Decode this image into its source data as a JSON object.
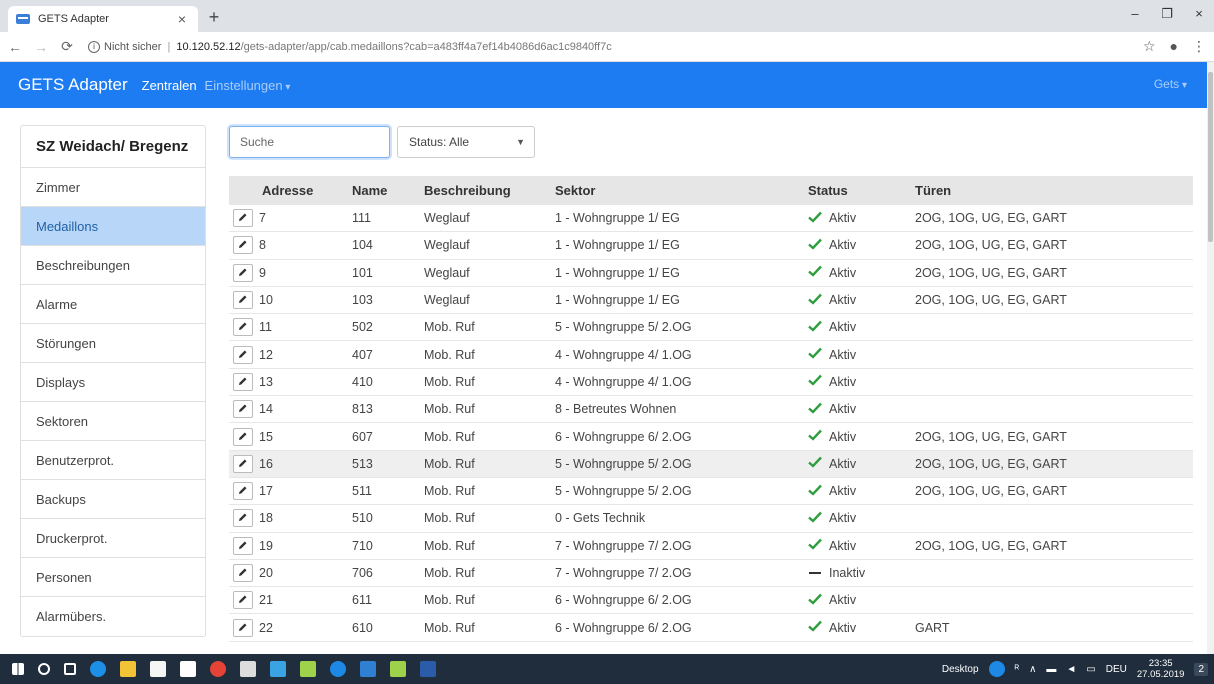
{
  "browser": {
    "tab_title": "GETS Adapter",
    "tab_close": "×",
    "new_tab": "+",
    "win_min": "–",
    "win_max": "❐",
    "win_close": "×",
    "url_security": "Nicht sicher",
    "url_host": "10.120.52.12",
    "url_path": "/gets-adapter/app/cab.medaillons?cab=a483ff4a7ef14b4086d6ac1c9840ff7c"
  },
  "navbar": {
    "brand": "GETS Adapter",
    "links": [
      "Zentralen",
      "Einstellungen"
    ],
    "user": "Gets"
  },
  "sidebar": {
    "title": "SZ Weidach/ Bregenz",
    "items": [
      "Zimmer",
      "Medaillons",
      "Beschreibungen",
      "Alarme",
      "Störungen",
      "Displays",
      "Sektoren",
      "Benutzerprot.",
      "Backups",
      "Druckerprot.",
      "Personen",
      "Alarmübers."
    ],
    "active_index": 1
  },
  "filters": {
    "search_placeholder": "Suche",
    "status_label": "Status: Alle"
  },
  "table": {
    "headers": [
      "Adresse",
      "Name",
      "Beschreibung",
      "Sektor",
      "Status",
      "Türen"
    ],
    "rows": [
      {
        "adresse": "7",
        "name": "111",
        "beschreibung": "Weglauf",
        "sektor": "1 - Wohngruppe 1/ EG",
        "status": "Aktiv",
        "tueren": "2OG, 1OG, UG, EG, GART"
      },
      {
        "adresse": "8",
        "name": "104",
        "beschreibung": "Weglauf",
        "sektor": "1 - Wohngruppe 1/ EG",
        "status": "Aktiv",
        "tueren": "2OG, 1OG, UG, EG, GART"
      },
      {
        "adresse": "9",
        "name": "101",
        "beschreibung": "Weglauf",
        "sektor": "1 - Wohngruppe 1/ EG",
        "status": "Aktiv",
        "tueren": "2OG, 1OG, UG, EG, GART"
      },
      {
        "adresse": "10",
        "name": "103",
        "beschreibung": "Weglauf",
        "sektor": "1 - Wohngruppe 1/ EG",
        "status": "Aktiv",
        "tueren": "2OG, 1OG, UG, EG, GART"
      },
      {
        "adresse": "11",
        "name": "502",
        "beschreibung": "Mob. Ruf",
        "sektor": "5 - Wohngruppe 5/ 2.OG",
        "status": "Aktiv",
        "tueren": ""
      },
      {
        "adresse": "12",
        "name": "407",
        "beschreibung": "Mob. Ruf",
        "sektor": "4 - Wohngruppe 4/ 1.OG",
        "status": "Aktiv",
        "tueren": ""
      },
      {
        "adresse": "13",
        "name": "410",
        "beschreibung": "Mob. Ruf",
        "sektor": "4 - Wohngruppe 4/ 1.OG",
        "status": "Aktiv",
        "tueren": ""
      },
      {
        "adresse": "14",
        "name": "813",
        "beschreibung": "Mob. Ruf",
        "sektor": "8 - Betreutes Wohnen",
        "status": "Aktiv",
        "tueren": ""
      },
      {
        "adresse": "15",
        "name": "607",
        "beschreibung": "Mob. Ruf",
        "sektor": "6 - Wohngruppe 6/ 2.OG",
        "status": "Aktiv",
        "tueren": "2OG, 1OG, UG, EG, GART"
      },
      {
        "adresse": "16",
        "name": "513",
        "beschreibung": "Mob. Ruf",
        "sektor": "5 - Wohngruppe 5/ 2.OG",
        "status": "Aktiv",
        "tueren": "2OG, 1OG, UG, EG, GART"
      },
      {
        "adresse": "17",
        "name": "511",
        "beschreibung": "Mob. Ruf",
        "sektor": "5 - Wohngruppe 5/ 2.OG",
        "status": "Aktiv",
        "tueren": "2OG, 1OG, UG, EG, GART"
      },
      {
        "adresse": "18",
        "name": "510",
        "beschreibung": "Mob. Ruf",
        "sektor": "0 - Gets Technik",
        "status": "Aktiv",
        "tueren": ""
      },
      {
        "adresse": "19",
        "name": "710",
        "beschreibung": "Mob. Ruf",
        "sektor": "7 - Wohngruppe 7/ 2.OG",
        "status": "Aktiv",
        "tueren": "2OG, 1OG, UG, EG, GART"
      },
      {
        "adresse": "20",
        "name": "706",
        "beschreibung": "Mob. Ruf",
        "sektor": "7 - Wohngruppe 7/ 2.OG",
        "status": "Inaktiv",
        "tueren": ""
      },
      {
        "adresse": "21",
        "name": "611",
        "beschreibung": "Mob. Ruf",
        "sektor": "6 - Wohngruppe 6/ 2.OG",
        "status": "Aktiv",
        "tueren": ""
      },
      {
        "adresse": "22",
        "name": "610",
        "beschreibung": "Mob. Ruf",
        "sektor": "6 - Wohngruppe 6/ 2.OG",
        "status": "Aktiv",
        "tueren": "GART"
      }
    ],
    "hover_row_index": 9
  },
  "taskbar": {
    "desktop_label": "Desktop",
    "lang": "DEU",
    "time": "23:35",
    "date": "27.05.2019",
    "notifications": "2"
  },
  "colors": {
    "navbar": "#1d7cf2",
    "active_sidebar": "#b8d7f8",
    "status_active": "#2e9e3f",
    "taskbar": "#1f2d3d"
  }
}
